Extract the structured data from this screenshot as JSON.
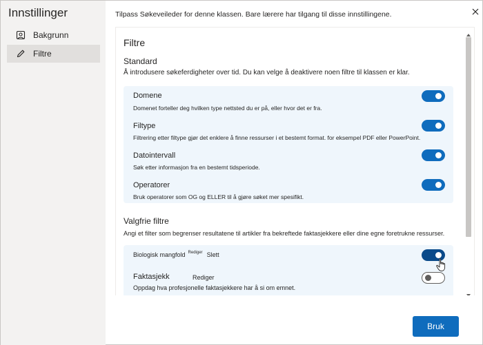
{
  "app": {
    "title": "Innstillinger"
  },
  "sidebar": {
    "items": [
      {
        "label": "Bakgrunn",
        "icon": "image-icon"
      },
      {
        "label": "Filtre",
        "icon": "pencil-icon",
        "active": true
      }
    ]
  },
  "header": {
    "description": "Tilpass Søkeveileder for denne klassen. Bare lærere har tilgang til disse innstillingene.",
    "close_icon": "close-icon"
  },
  "panel": {
    "title": "Filtre",
    "standard": {
      "title": "Standard",
      "description": "Å introdusere søkeferdigheter over tid. Du kan velge å deaktivere noen filtre til klassen er klar.",
      "filters": [
        {
          "name": "Domene",
          "description": "Domenet forteller deg hvilken type nettsted du er på, eller hvor det er fra.",
          "enabled": true
        },
        {
          "name": "Filtype",
          "description": "Filtrering etter filtype gjør det enklere å finne ressurser i et bestemt format. for eksempel PDF eller PowerPoint.",
          "enabled": true
        },
        {
          "name": "Datointervall",
          "description": "Søk etter informasjon fra en bestemt tidsperiode.",
          "enabled": true
        },
        {
          "name": "Operatorer",
          "description": "Bruk operatorer som OG og ELLER til å gjøre søket mer spesifikt.",
          "enabled": true
        }
      ]
    },
    "optional": {
      "title": "Valgfrie filtre",
      "description": "Angi et filter som begrenser resultatene til artikler fra bekreftede faktasjekkere eller dine egne foretrukne ressurser.",
      "filters": [
        {
          "name": "Biologisk mangfold",
          "edit_label": "Rediger",
          "delete_label": "Slett",
          "enabled": true
        },
        {
          "name": "Faktasjekk",
          "edit_label": "Rediger",
          "description": "Oppdag hva profesjonelle faktasjekkere har å si om emnet.",
          "enabled": false
        }
      ]
    }
  },
  "footer": {
    "primary_label": "Bruk"
  },
  "colors": {
    "accent": "#0f6cbd",
    "card_bg": "#eff6fc",
    "sidebar_bg": "#f3f2f1"
  }
}
